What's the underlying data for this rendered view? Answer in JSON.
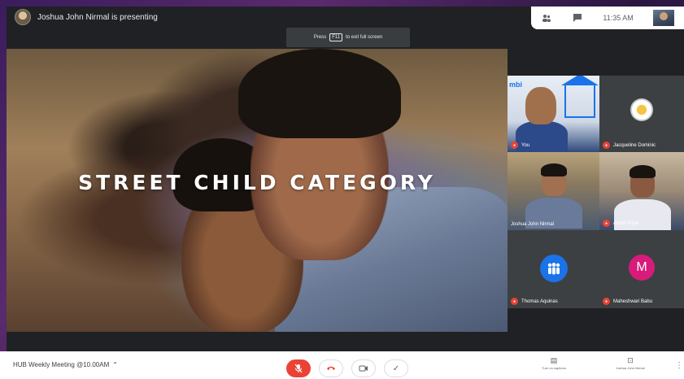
{
  "presenter": {
    "text": "Joshua John Nirmal is presenting"
  },
  "fullscreen_hint": {
    "before": "Press",
    "key": "F11",
    "after": "to exit full screen"
  },
  "top_right": {
    "time": "11:35 AM",
    "people_icon": "people-icon",
    "chat_icon": "chat-icon"
  },
  "slide": {
    "title": "STREET CHILD CATEGORY"
  },
  "participants": [
    {
      "name": "You",
      "brand": "mbi"
    },
    {
      "name": "Jacqueline Dominic"
    },
    {
      "name": "Joshua John Nirmal"
    },
    {
      "name": "Arathi Priya"
    },
    {
      "name": "Thomas Aquinas"
    },
    {
      "name": "Maheshwari Babu",
      "initial": "M"
    }
  ],
  "bottom": {
    "meeting_title": "HUB Weekly Meeting @10.00AM",
    "turn_on_captions": "Turn on captions",
    "presenter_label": "Joshua John Nirmal"
  },
  "colors": {
    "mic_off": "#ea4335",
    "accent_blue": "#1a73e8",
    "tile_bg": "#3c4043"
  }
}
